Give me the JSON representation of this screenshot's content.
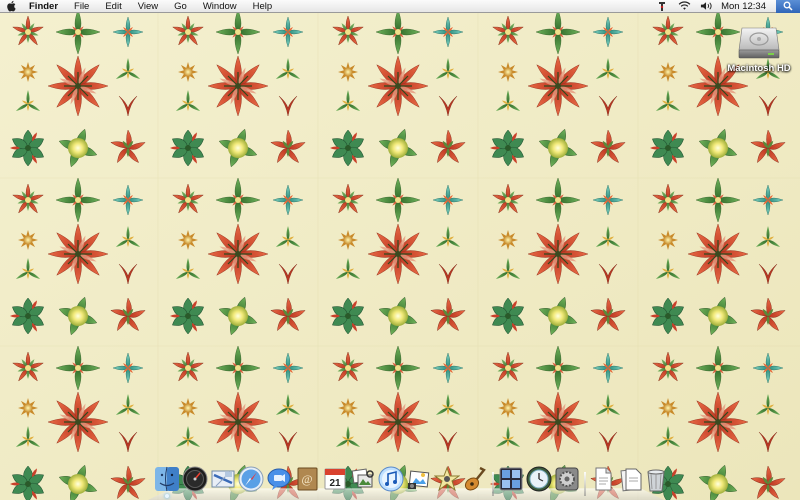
{
  "menubar": {
    "apple_icon": "apple-logo-icon",
    "app_name": "Finder",
    "menus": [
      "File",
      "Edit",
      "View",
      "Go",
      "Window",
      "Help"
    ],
    "status_icons": [
      "script-menu-icon",
      "wifi-icon",
      "volume-icon"
    ],
    "clock": "Mon 12:34",
    "spotlight_icon": "spotlight-search-icon"
  },
  "desktop": {
    "wallpaper": "floral-pattern",
    "colors": {
      "background": "#f2eecb",
      "red": "#d8482c",
      "green": "#4d8a3a",
      "teal": "#3aa08a"
    },
    "icons": [
      {
        "label": "Macintosh HD",
        "icon": "hard-drive-icon"
      }
    ]
  },
  "dock": {
    "apps": [
      {
        "name": "Finder",
        "icon": "finder-icon",
        "running": true
      },
      {
        "name": "Dashboard",
        "icon": "dashboard-icon",
        "running": false
      },
      {
        "name": "Mail",
        "icon": "mail-icon",
        "running": false
      },
      {
        "name": "Safari",
        "icon": "safari-icon",
        "running": false
      },
      {
        "name": "iChat",
        "icon": "ichat-icon",
        "running": false
      },
      {
        "name": "Address Book",
        "icon": "address-book-icon",
        "running": false
      },
      {
        "name": "iCal",
        "icon": "ical-icon",
        "calendar_day": "21",
        "running": false
      },
      {
        "name": "Preview",
        "icon": "preview-icon",
        "running": false
      },
      {
        "name": "iTunes",
        "icon": "itunes-icon",
        "running": false
      },
      {
        "name": "iPhoto",
        "icon": "iphoto-icon",
        "running": false
      },
      {
        "name": "iMovie",
        "icon": "imovie-icon",
        "running": false
      },
      {
        "name": "GarageBand",
        "icon": "garageband-icon",
        "running": false
      },
      {
        "name": "Spaces",
        "icon": "spaces-icon",
        "running": false
      },
      {
        "name": "Time Machine",
        "icon": "time-machine-icon",
        "running": false
      },
      {
        "name": "System Preferences",
        "icon": "system-preferences-icon",
        "running": false
      }
    ],
    "stacks": [
      {
        "name": "Documents",
        "icon": "documents-stack-icon"
      },
      {
        "name": "Downloads",
        "icon": "downloads-stack-icon"
      },
      {
        "name": "Trash",
        "icon": "trash-icon"
      }
    ]
  }
}
